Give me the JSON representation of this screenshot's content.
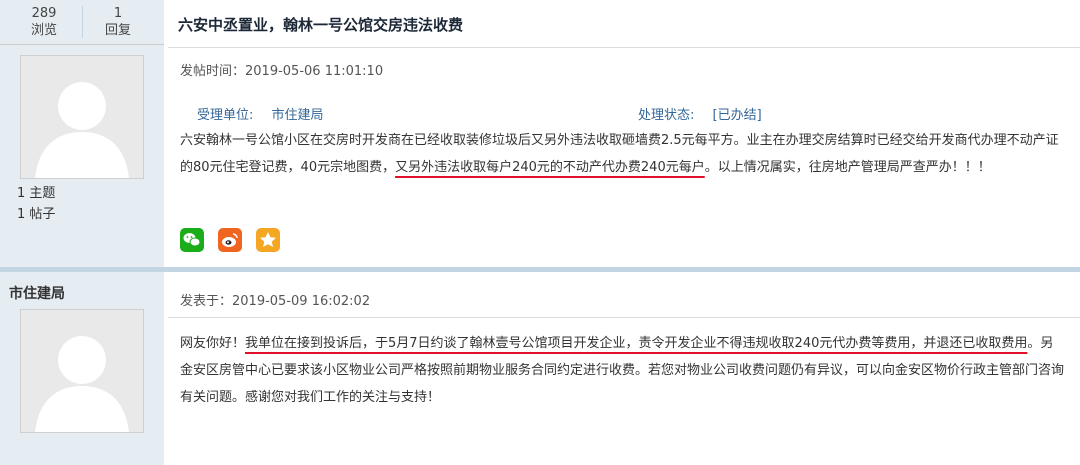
{
  "thread": {
    "views": "289",
    "views_label": "浏览",
    "replies": "1",
    "replies_label": "回复",
    "title": "六安中丞置业，翰林一号公馆交房违法收费"
  },
  "post1": {
    "user_stats": {
      "topics": "1 主题",
      "posts": "1 帖子"
    },
    "posted_label": "发帖时间：",
    "posted_time": "2019-05-06 11:01:10",
    "handler_label": "受理单位:",
    "handler_value": "市住建局",
    "status_label": "处理状态:",
    "status_value": "[已办结]",
    "content_part1": "六安翰林一号公馆小区在交房时开发商在已经收取装修垃圾后又另外违法收取砸墙费2.5元每平方。业主在办理交房结算时已经交给开发商代办理不动产证的80元住宅登记费，40元宗地图费，",
    "content_highlight": "又另外违法收取每户240元的不动产代办费240元每户",
    "content_part2": "。以上情况属实，往房地产管理局严查严办！！！",
    "share_icons": [
      "wechat-icon",
      "weibo-icon",
      "favorite-star-icon"
    ]
  },
  "post2": {
    "username": "市住建局",
    "posted_label": "发表于：",
    "posted_time": "2019-05-09 16:02:02",
    "content_part1": "网友你好！",
    "content_highlight": "我单位在接到投诉后，于5月7日约谈了翰林壹号公馆项目开发企业，责令开发企业不得违规收取240元代办费等费用，并退还已收取费用",
    "content_part2": "。另金安区房管中心已要求该小区物业公司严格按照前期物业服务合同约定进行收费。若您对物业公司收费问题仍有异议，可以向金安区物价行政主管部门咨询有关问题。感谢您对我们工作的关注与支持！"
  },
  "colors": {
    "accent_blue": "#336699",
    "highlight_underline": "#e0102a",
    "wechat": "#1aad19",
    "weibo": "#f0651f",
    "favorite": "#f5a623"
  }
}
